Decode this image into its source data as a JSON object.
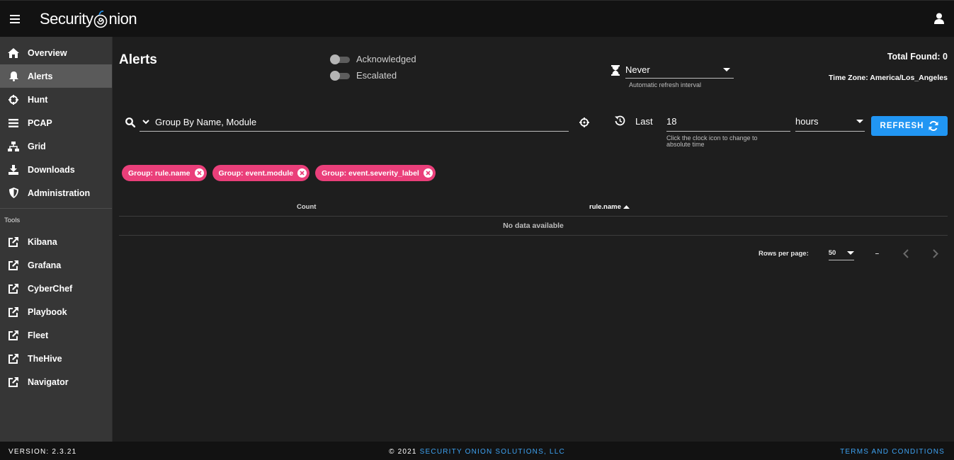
{
  "app": {
    "logo_left": "Security",
    "logo_right": "nion"
  },
  "sidebar": {
    "items": [
      {
        "label": "Overview",
        "icon": "home-icon"
      },
      {
        "label": "Alerts",
        "icon": "bell-icon",
        "active": true
      },
      {
        "label": "Hunt",
        "icon": "crosshair-icon"
      },
      {
        "label": "PCAP",
        "icon": "stream-icon"
      },
      {
        "label": "Grid",
        "icon": "sitemap-icon"
      },
      {
        "label": "Downloads",
        "icon": "download-icon"
      },
      {
        "label": "Administration",
        "icon": "shield-icon"
      }
    ],
    "tools_label": "Tools",
    "tools": [
      {
        "label": "Kibana",
        "icon": "external-link-icon"
      },
      {
        "label": "Grafana",
        "icon": "external-link-icon"
      },
      {
        "label": "CyberChef",
        "icon": "external-link-icon"
      },
      {
        "label": "Playbook",
        "icon": "external-link-icon"
      },
      {
        "label": "Fleet",
        "icon": "external-link-icon"
      },
      {
        "label": "TheHive",
        "icon": "external-link-icon"
      },
      {
        "label": "Navigator",
        "icon": "external-link-icon"
      }
    ]
  },
  "main": {
    "title": "Alerts",
    "toggles": {
      "acknowledged": {
        "label": "Acknowledged",
        "on": false
      },
      "escalated": {
        "label": "Escalated",
        "on": false
      }
    },
    "refresh_interval": {
      "value": "Never",
      "hint": "Automatic refresh interval"
    },
    "total_found": "Total Found: 0",
    "time_zone": "Time Zone: America/Los_Angeles",
    "query": {
      "value": "Group By Name, Module"
    },
    "time_range": {
      "label": "Last",
      "value": "18",
      "hint": "Click the clock icon to change to absolute time",
      "unit": "hours"
    },
    "refresh_label": "REFRESH",
    "chips": [
      "Group: rule.name",
      "Group: event.module",
      "Group: event.severity_label"
    ],
    "table": {
      "columns": [
        "Count",
        "rule.name"
      ],
      "empty": "No data available"
    },
    "pagination": {
      "rows_per_page_label": "Rows per page:",
      "rows_per_page": "50",
      "range": "–"
    }
  },
  "footer": {
    "version": "VERSION: 2.3.21",
    "copyright_prefix": "© 2021 ",
    "copyright_link": "SECURITY ONION SOLUTIONS, LLC",
    "terms": "TERMS AND CONDITIONS"
  },
  "colors": {
    "accent": "#2196f3",
    "chip": "#ea3f7a",
    "sidebar": "#363636",
    "appbar": "#121212"
  }
}
